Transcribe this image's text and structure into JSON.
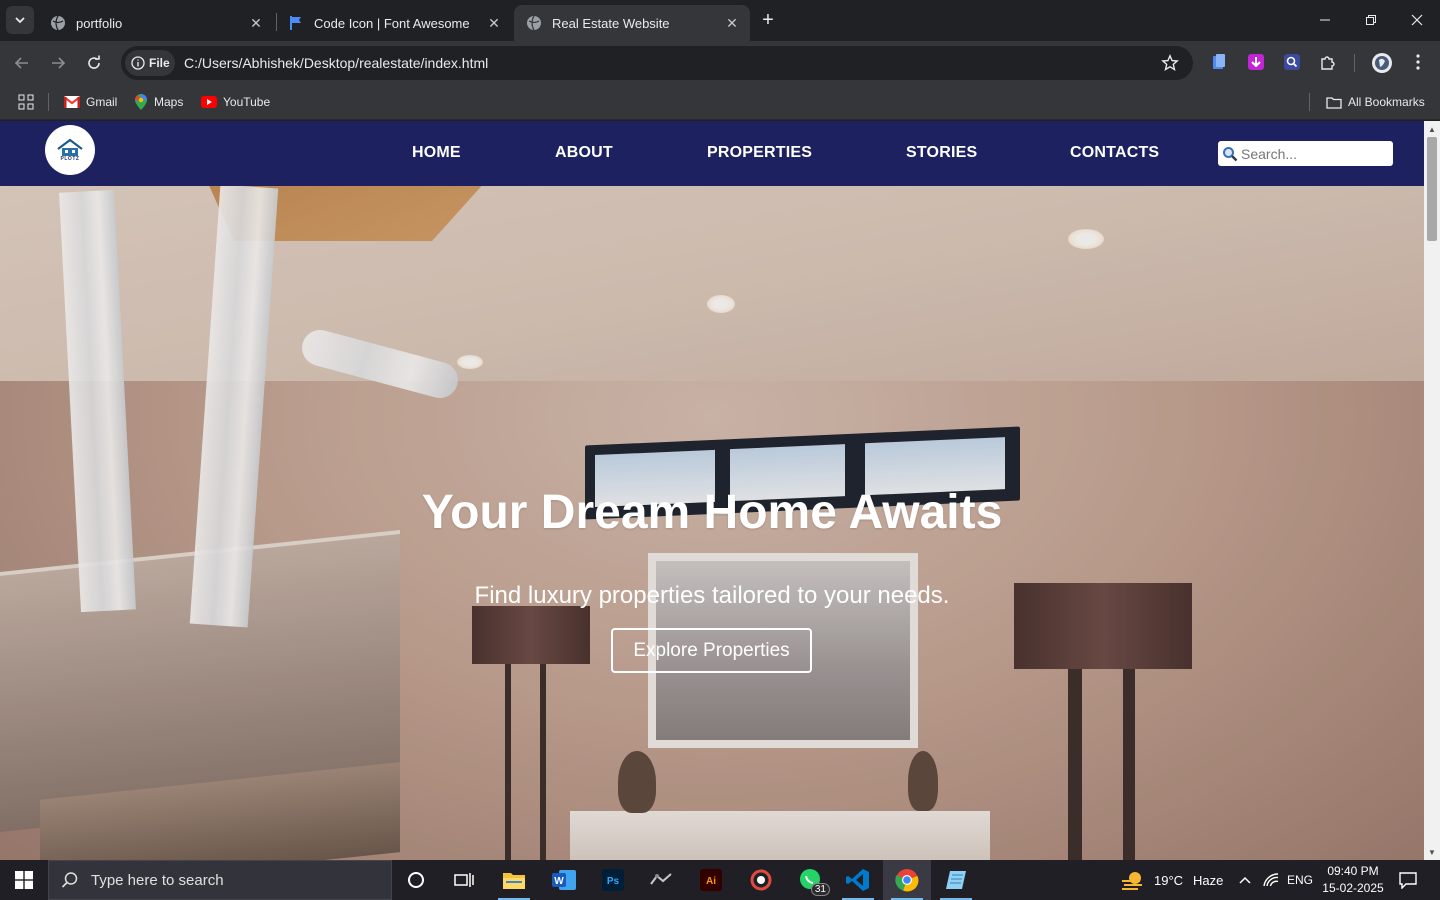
{
  "browser": {
    "tabs": [
      {
        "title": "portfolio",
        "active": false
      },
      {
        "title": "Code Icon | Font Awesome",
        "active": false
      },
      {
        "title": "Real Estate Website",
        "active": true
      }
    ],
    "address": {
      "scheme_label": "File",
      "url": "C:/Users/Abhishek/Desktop/realestate/index.html"
    },
    "bookmarks": [
      {
        "label": "Gmail",
        "icon": "gmail-icon"
      },
      {
        "label": "Maps",
        "icon": "maps-icon"
      },
      {
        "label": "YouTube",
        "icon": "youtube-icon"
      }
    ],
    "all_bookmarks_label": "All Bookmarks"
  },
  "site": {
    "logo_text": "PLOTZ",
    "nav": [
      {
        "label": "HOME"
      },
      {
        "label": "ABOUT"
      },
      {
        "label": "PROPERTIES"
      },
      {
        "label": "STORIES"
      },
      {
        "label": "CONTACTS"
      }
    ],
    "search_placeholder": "Search...",
    "hero": {
      "title": "Your Dream Home Awaits",
      "subtitle": "Find luxury properties tailored to your needs.",
      "cta": "Explore Properties"
    },
    "colors": {
      "nav_bg": "#1e2160",
      "text": "#ffffff"
    }
  },
  "taskbar": {
    "search_placeholder": "Type here to search",
    "apps": [
      {
        "name": "cortana-icon"
      },
      {
        "name": "task-view-icon"
      },
      {
        "name": "file-explorer-icon"
      },
      {
        "name": "word-icon",
        "label": "W"
      },
      {
        "name": "photoshop-icon",
        "label": "Ps"
      },
      {
        "name": "app-icon"
      },
      {
        "name": "illustrator-icon",
        "label": "Ai"
      },
      {
        "name": "davinci-icon"
      },
      {
        "name": "whatsapp-icon",
        "badge": "31"
      },
      {
        "name": "vscode-icon"
      },
      {
        "name": "chrome-icon"
      },
      {
        "name": "notepad-icon"
      }
    ],
    "weather": {
      "temp": "19°C",
      "condition": "Haze"
    },
    "language": "ENG",
    "time": "09:40 PM",
    "date": "15-02-2025"
  }
}
